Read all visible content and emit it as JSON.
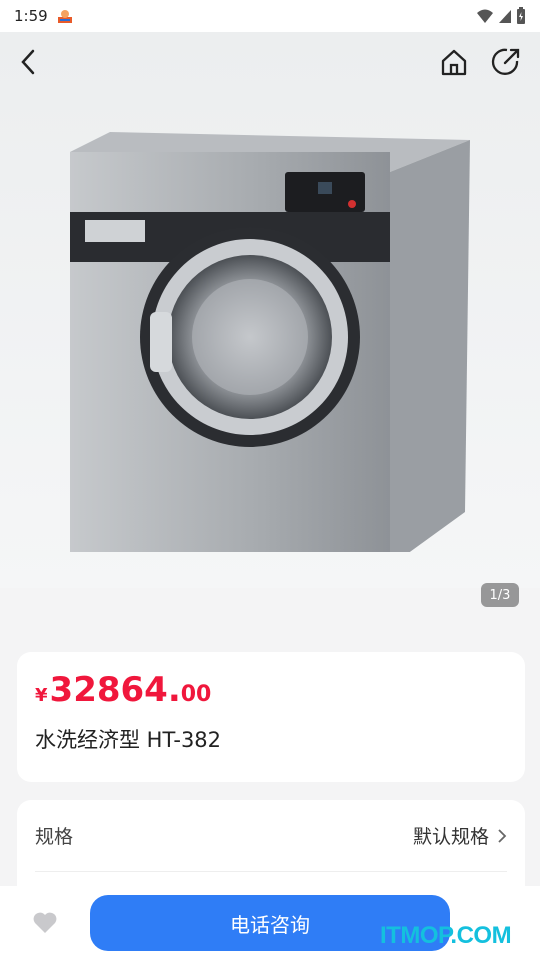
{
  "status": {
    "time": "1:59"
  },
  "gallery": {
    "counter": "1/3"
  },
  "product": {
    "currency": "¥",
    "price_int": "32864.",
    "price_dec": "00",
    "name": "水洗经济型 HT-382"
  },
  "spec": {
    "label": "规格",
    "value": "默认规格"
  },
  "bottom": {
    "call_label": "电话咨询"
  },
  "watermark": "ITMOP.COM",
  "colors": {
    "price": "#f0173c",
    "button": "#2f7df6",
    "watermark": "#14c0de"
  }
}
